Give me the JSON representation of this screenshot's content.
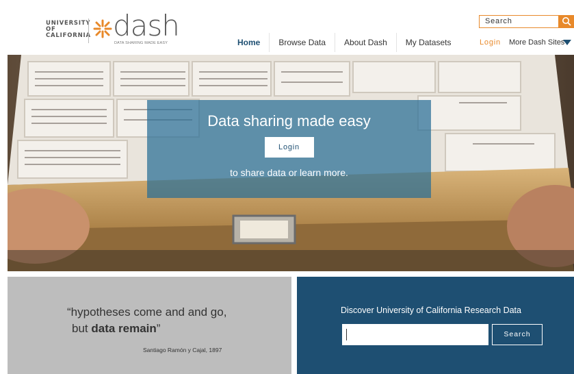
{
  "header": {
    "uc_logo_lines": [
      "UNIVERSITY",
      "OF",
      "CALIFORNIA"
    ],
    "dash_logo": "dash",
    "dash_tagline": "DATA SHARING MADE EASY",
    "search_placeholder": "Search",
    "login_link": "Login",
    "more_sites": "More Dash Sites",
    "nav": [
      {
        "label": "Home",
        "active": true
      },
      {
        "label": "Browse Data"
      },
      {
        "label": "About Dash"
      },
      {
        "label": "My Datasets"
      }
    ],
    "accent_color": "#e8892a",
    "brand_color": "#1e4f72"
  },
  "hero": {
    "title": "Data sharing made easy",
    "login_button": "Login",
    "subtitle": "to share data or learn more."
  },
  "quote": {
    "line1": "“hypotheses come and and go,",
    "line2_plain": "but ",
    "line2_bold": "data remain",
    "line2_end": "”",
    "citation": "Santiago Ramón y Cajal, 1897"
  },
  "discover": {
    "title": "Discover University of California Research Data",
    "input_value": "",
    "search_button": "Search"
  }
}
